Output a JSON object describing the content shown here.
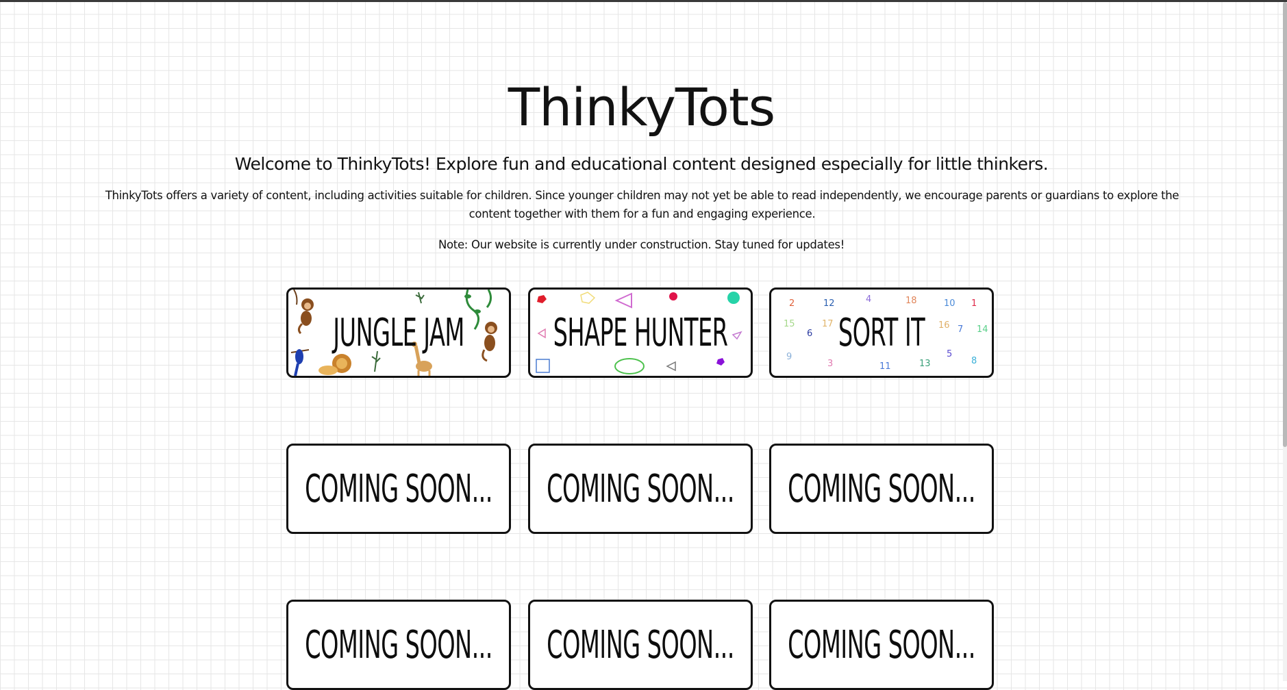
{
  "site": {
    "title": "ThinkyTots",
    "tagline": "Welcome to ThinkyTots! Explore fun and educational content designed especially for little thinkers.",
    "intro": "ThinkyTots offers a variety of content, including activities suitable for children. Since younger children may not yet be able to read independently, we encourage parents or guardians to explore the content together with them for a fun and engaging experience.",
    "note": "Note: Our website is currently under construction. Stay tuned for updates!"
  },
  "cards": [
    {
      "label": "JUNGLE JAM",
      "theme": "jungle-animals"
    },
    {
      "label": "SHAPE HUNTER",
      "theme": "shapes"
    },
    {
      "label": "SORT IT",
      "theme": "numbers"
    },
    {
      "label": "COMING SOON..."
    },
    {
      "label": "COMING SOON..."
    },
    {
      "label": "COMING SOON..."
    },
    {
      "label": "COMING SOON..."
    },
    {
      "label": "COMING SOON..."
    },
    {
      "label": "COMING SOON..."
    }
  ],
  "sort_it_numbers": [
    "2",
    "12",
    "4",
    "18",
    "10",
    "1",
    "15",
    "6",
    "17",
    "16",
    "7",
    "14",
    "9",
    "3",
    "11",
    "13",
    "5",
    "8"
  ],
  "colors": {
    "grid": "#e6e6e6",
    "border": "#111111",
    "background": "#ffffff"
  }
}
